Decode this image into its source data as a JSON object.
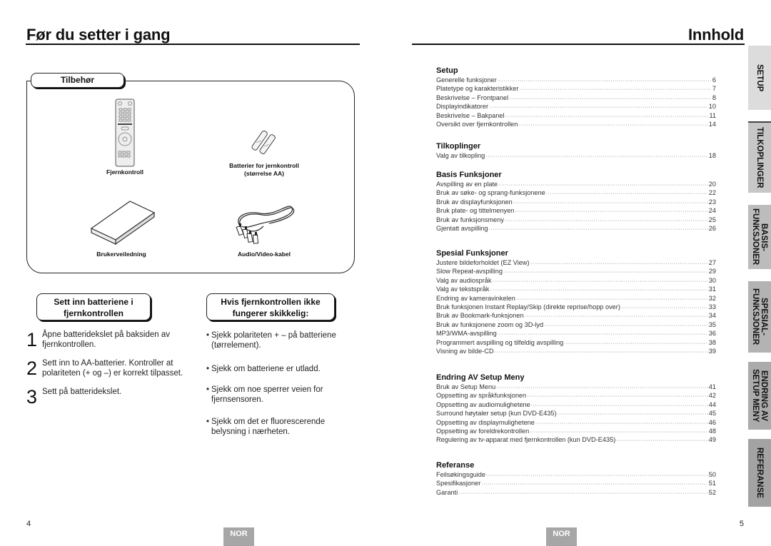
{
  "left_page": {
    "title": "Før du setter i gang",
    "accessories": {
      "heading": "Tilbehør",
      "items": [
        {
          "icon": "remote-control-icon",
          "label": "Fjernkontroll"
        },
        {
          "icon": "batteries-icon",
          "label": "Batterier for jernkontroll\n(størrelse AA)",
          "label_line1": "Batterier for jernkontroll",
          "label_line2": "(størrelse AA)"
        },
        {
          "icon": "manual-icon",
          "label": "Brukerveiledning"
        },
        {
          "icon": "av-cable-icon",
          "label": "Audio/Video-kabel"
        }
      ]
    },
    "insert_batteries": {
      "heading_line1": "Sett inn batteriene i",
      "heading_line2": "fjernkontrollen",
      "steps": [
        {
          "num": "1",
          "text": "Åpne batteridekslet på baksiden av fjernkontrollen."
        },
        {
          "num": "2",
          "text": "Sett inn to AA-batterier. Kontroller at polariteten (+ og –) er korrekt tilpasset."
        },
        {
          "num": "3",
          "text": "Sett på batteridekslet."
        }
      ]
    },
    "troubleshoot": {
      "heading_line1": "Hvis fjernkontrollen ikke",
      "heading_line2": "fungerer skikkelig:",
      "bullets": [
        "Sjekk polariteten + – på batteriene (tørrelement).",
        "Sjekk om batteriene er utladd.",
        "Sjekk om noe sperrer veien for fjernsensoren.",
        "Sjekk om det er fluorescerende belysning i nærheten."
      ]
    },
    "page_number": "4",
    "language_badge": "NOR"
  },
  "right_page": {
    "title": "Innhold",
    "toc": [
      {
        "heading": "Setup",
        "entries": [
          {
            "label": "Generelle funksjoner",
            "page": "6"
          },
          {
            "label": "Platetype og karakteristikker",
            "page": "7"
          },
          {
            "label": "Beskrivelse – Frontpanel",
            "page": "8"
          },
          {
            "label": "Displayindikatorer",
            "page": "10"
          },
          {
            "label": "Beskrivelse – Bakpanel",
            "page": "11"
          },
          {
            "label": "Oversikt over fjernkontrollen",
            "page": "14"
          }
        ]
      },
      {
        "heading": "Tilkoplinger",
        "entries": [
          {
            "label": "Valg av tilkopling",
            "page": "18"
          }
        ]
      },
      {
        "heading": "Basis Funksjoner",
        "entries": [
          {
            "label": "Avspilling av en plate",
            "page": "20"
          },
          {
            "label": "Bruk av søke- og sprang-funksjonene",
            "page": "22"
          },
          {
            "label": "Bruk av displayfunksjonen",
            "page": "23"
          },
          {
            "label": "Bruk plate- og tittelmenyen",
            "page": "24"
          },
          {
            "label": "Bruk av funksjonsmeny",
            "page": "25"
          },
          {
            "label": "Gjentatt avspilling",
            "page": "26"
          }
        ]
      },
      {
        "heading": "Spesial Funksjoner",
        "entries": [
          {
            "label": "Justere bildeforholdet (EZ View)",
            "page": "27"
          },
          {
            "label": "Slow Repeat-avspilling",
            "page": "29"
          },
          {
            "label": "Valg av audiospråk",
            "page": "30"
          },
          {
            "label": "Valg av tekstspråk",
            "page": "31"
          },
          {
            "label": "Endring av kameravinkelen",
            "page": "32"
          },
          {
            "label": "Bruk funksjonen Instant Replay/Skip (direkte reprise/hopp over)",
            "page": "33"
          },
          {
            "label": "Bruk av Bookmark-funksjonen",
            "page": "34"
          },
          {
            "label": "Bruk av funksjonene zoom og 3D-lyd",
            "page": "35"
          },
          {
            "label": "MP3/WMA-avspilling",
            "page": "36"
          },
          {
            "label": "Programmert avspilling og tilfeldig avspilling",
            "page": "38"
          },
          {
            "label": "Visning av bilde-CD",
            "page": "39"
          }
        ]
      },
      {
        "heading": "Endring AV Setup Meny",
        "entries": [
          {
            "label": "Bruk av Setup Menu",
            "page": "41"
          },
          {
            "label": "Oppsetting av språkfunksjonen",
            "page": "42"
          },
          {
            "label": "Oppsetting av audiomulighetene",
            "page": "44"
          },
          {
            "label": "Surround høytaler setup (kun DVD-E435)",
            "page": "45"
          },
          {
            "label": "Oppsetting av displaymulighetene",
            "page": "46"
          },
          {
            "label": "Oppsetting av foreldrekontrollen",
            "page": "48"
          },
          {
            "label": "Regulering av tv-apparat med fjernkontrollen (kun DVD-E435)",
            "page": "49"
          }
        ]
      },
      {
        "heading": "Referanse",
        "entries": [
          {
            "label": "Feilsøkingsguide",
            "page": "50"
          },
          {
            "label": "Spesifikasjoner",
            "page": "51"
          },
          {
            "label": "Garanti",
            "page": "52"
          }
        ]
      }
    ],
    "side_tabs": [
      {
        "label": "SETUP"
      },
      {
        "label": "TILKOPLINGER"
      },
      {
        "label": "BASIS-\nFUNKSJONER"
      },
      {
        "label": "SPESIAL-\nFUNKSJONER"
      },
      {
        "label": "ENDRING AV\nSETUP MENY"
      },
      {
        "label": "REFERANSE"
      }
    ],
    "page_number": "5",
    "language_badge": "NOR"
  }
}
